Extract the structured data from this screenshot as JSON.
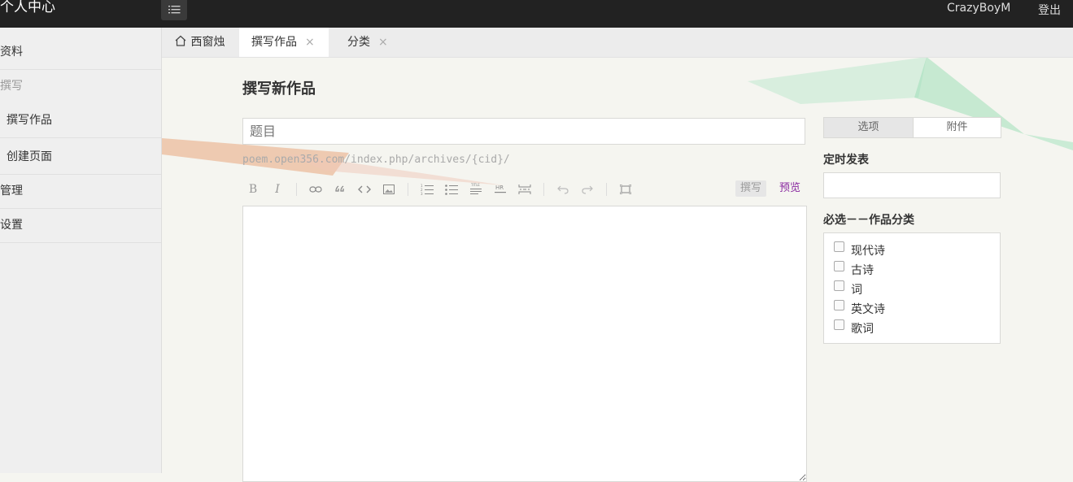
{
  "header": {
    "brand": "个人中心",
    "user": "CrazyBoyM",
    "logout": "登出"
  },
  "sidebar": {
    "items": [
      {
        "label": "资料"
      },
      {
        "label": "撰写"
      },
      {
        "label": "撰写作品"
      },
      {
        "label": "创建页面"
      },
      {
        "label": "管理"
      },
      {
        "label": "设置"
      }
    ]
  },
  "tabs": [
    {
      "label": "西窗烛",
      "icon": "home-icon"
    },
    {
      "label": "撰写作品",
      "close": "×"
    },
    {
      "label": "分类",
      "close": "×"
    }
  ],
  "main": {
    "title": "撰写新作品",
    "title_placeholder": "题目",
    "slug": "poem.open356.com/index.php/archives/{cid}/",
    "toolbar": {
      "bold": "B",
      "italic": "I",
      "write_mode": "撰写",
      "preview_mode": "预览"
    }
  },
  "right_panel": {
    "tab_options": "选项",
    "tab_attachments": "附件",
    "schedule_label": "定时发表",
    "category_label": "必选－－作品分类",
    "categories": [
      "现代诗",
      "古诗",
      "词",
      "英文诗",
      "歌词"
    ]
  },
  "colors": {
    "topbar": "#222222",
    "preview_link": "#8a2aa0",
    "background": "#f5f5f0"
  }
}
